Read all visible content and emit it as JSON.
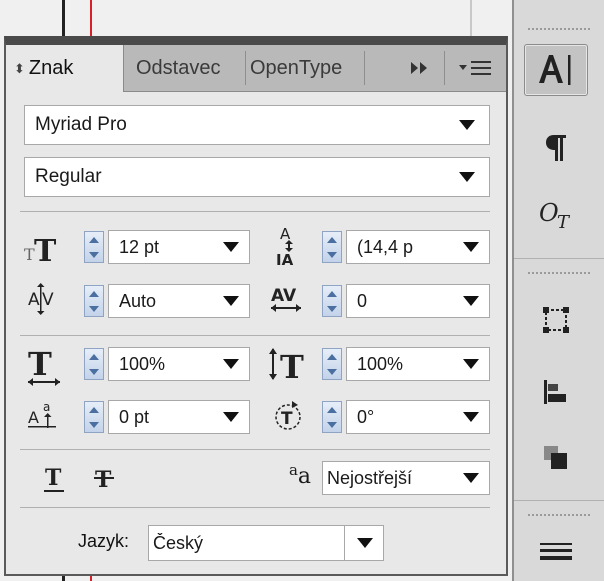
{
  "panel": {
    "tabs": [
      {
        "label": "Znak",
        "active": true
      },
      {
        "label": "Odstavec",
        "active": false
      },
      {
        "label": "OpenType",
        "active": false
      }
    ],
    "font_family": "Myriad Pro",
    "font_style": "Regular",
    "font_size": "12 pt",
    "leading": "(14,4 p",
    "kerning": "Auto",
    "tracking": "0",
    "vertical_scale": "100%",
    "horizontal_scale": "100%",
    "baseline_shift": "0 pt",
    "character_rotation": "0°",
    "anti_aliasing": "Nejostřejší",
    "language_label": "Jazyk:",
    "language": "Český",
    "aa_icon_text": "a",
    "aa_icon_text2": "a"
  },
  "tool_column": {
    "items": [
      "character-panel-icon",
      "paragraph-panel-icon",
      "opentype-panel-icon",
      "transform-panel-icon",
      "align-panel-icon",
      "pathfinder-panel-icon",
      "stroke-panel-icon"
    ]
  },
  "colors": {
    "accent_red": "#d8202a",
    "spinner": "#4a6fa0"
  }
}
